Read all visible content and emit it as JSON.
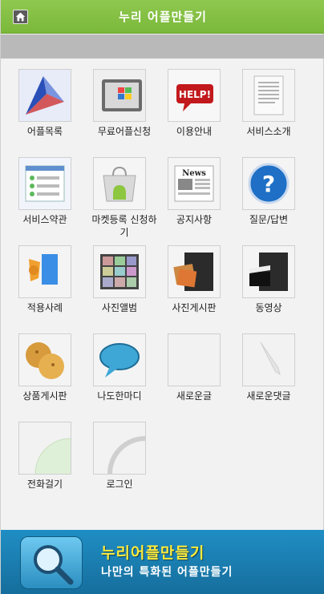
{
  "header": {
    "title": "누리 어플만들기",
    "home_icon": "home-icon"
  },
  "menu": [
    {
      "label": "어플목록",
      "icon": "app-list-icon"
    },
    {
      "label": "무료어플신청",
      "icon": "windows-icon"
    },
    {
      "label": "이용안내",
      "icon": "help-icon"
    },
    {
      "label": "서비스소개",
      "icon": "document-icon"
    },
    {
      "label": "서비스약관",
      "icon": "terms-icon"
    },
    {
      "label": "마켓등록 신청하기",
      "icon": "android-market-icon"
    },
    {
      "label": "공지사항",
      "icon": "news-icon"
    },
    {
      "label": "질문/답변",
      "icon": "question-icon"
    },
    {
      "label": "적용사례",
      "icon": "case-icon"
    },
    {
      "label": "사진앨범",
      "icon": "photo-album-icon"
    },
    {
      "label": "사진게시판",
      "icon": "photo-board-icon"
    },
    {
      "label": "동영상",
      "icon": "video-icon"
    },
    {
      "label": "상품게시판",
      "icon": "product-icon"
    },
    {
      "label": "나도한마디",
      "icon": "speech-bubble-icon"
    },
    {
      "label": "새로운글",
      "icon": "new-post-icon"
    },
    {
      "label": "새로운댓글",
      "icon": "new-comment-icon"
    },
    {
      "label": "전화걸기",
      "icon": "phone-icon"
    },
    {
      "label": "로그인",
      "icon": "login-icon"
    }
  ],
  "banner": {
    "title": "누리어플만들기",
    "subtitle": "나만의 특화된 어플만들기",
    "icon": "magnifier-icon"
  },
  "colors": {
    "header_green": "#7ab83a",
    "banner_blue": "#1f8ec4",
    "banner_title": "#ffeb3b"
  }
}
